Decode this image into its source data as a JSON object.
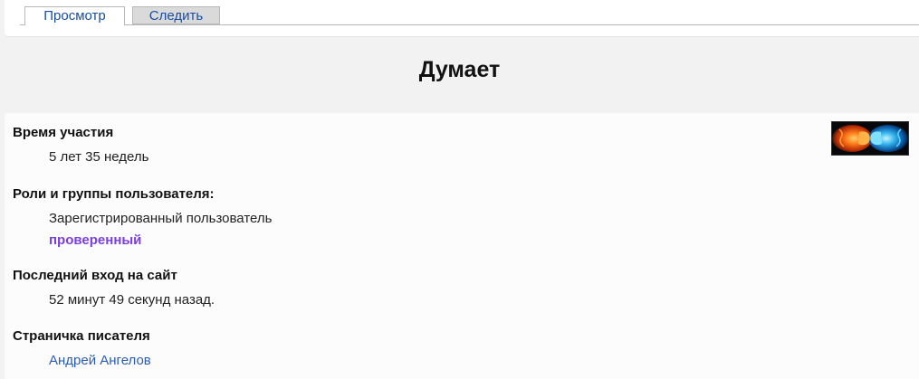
{
  "tabs": [
    {
      "label": "Просмотр",
      "active": true
    },
    {
      "label": "Следить",
      "active": false
    }
  ],
  "page_title": "Думает",
  "avatar": {
    "description_icon": "fire-water-fists-icon"
  },
  "profile": {
    "membership": {
      "label": "Время участия",
      "value": "5 лет 35 недель"
    },
    "roles": {
      "label": "Роли и группы пользователя:",
      "items": [
        "Зарегистрированный пользователь",
        "проверенный"
      ]
    },
    "last_login": {
      "label": "Последний вход на сайт",
      "value": "52 минут 49 секунд назад."
    },
    "writer_page": {
      "label": "Страничка писателя",
      "link_text": "Андрей Ангелов"
    }
  },
  "colors": {
    "link": "#2a5db0",
    "verified_role": "#7b3fe0",
    "background": "#f2f2f2"
  }
}
